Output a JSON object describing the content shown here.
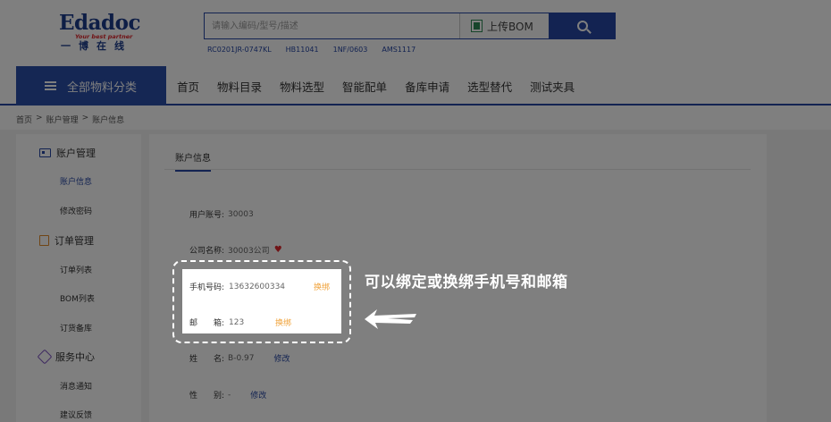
{
  "logo": {
    "word": "Edadoc",
    "slogan": "Your best partner",
    "cn": "一博在线"
  },
  "search": {
    "placeholder": "请输入编码/型号/描述",
    "upload_label": "上传BOM",
    "hot_words": [
      "RC0201JR-0747KL",
      "HB11041",
      "1NF/0603",
      "AMS1117"
    ]
  },
  "nav": {
    "all_categories": "全部物料分类",
    "items": [
      "首页",
      "物料目录",
      "物料选型",
      "智能配单",
      "备库申请",
      "选型替代",
      "测试夹具"
    ]
  },
  "breadcrumb": {
    "items": [
      "首页",
      "账户管理",
      "账户信息"
    ],
    "separator": ">"
  },
  "sidebar": {
    "groups": [
      {
        "title": "账户管理",
        "icon": "id-card-icon",
        "items": [
          "账户信息",
          "修改密码"
        ]
      },
      {
        "title": "订单管理",
        "icon": "order-icon",
        "items": [
          "订单列表",
          "BOM列表",
          "订货备库"
        ]
      },
      {
        "title": "服务中心",
        "icon": "service-icon",
        "items": [
          "消息通知",
          "建议反馈"
        ]
      }
    ]
  },
  "account": {
    "tab_title": "账户信息",
    "user_account": {
      "label": "用户账号:",
      "value": "30003"
    },
    "company": {
      "label": "公司名称:",
      "value": "30003公司"
    },
    "phone": {
      "label": "手机号码:",
      "value": "13632600334",
      "link": "换绑"
    },
    "email": {
      "label": "邮　　箱:",
      "value": "123",
      "link": "换绑"
    },
    "name": {
      "label": "姓　　名:",
      "value": "B-0.97",
      "link": "修改"
    },
    "gender": {
      "label": "性　　别:",
      "value": "-",
      "link": "修改"
    }
  },
  "annotation": {
    "text": "可以绑定或换绑手机号和邮箱"
  },
  "colors": {
    "brand_blue": "#2647a4",
    "accent_orange": "#f0a33c",
    "logo_red": "#e0262c"
  }
}
